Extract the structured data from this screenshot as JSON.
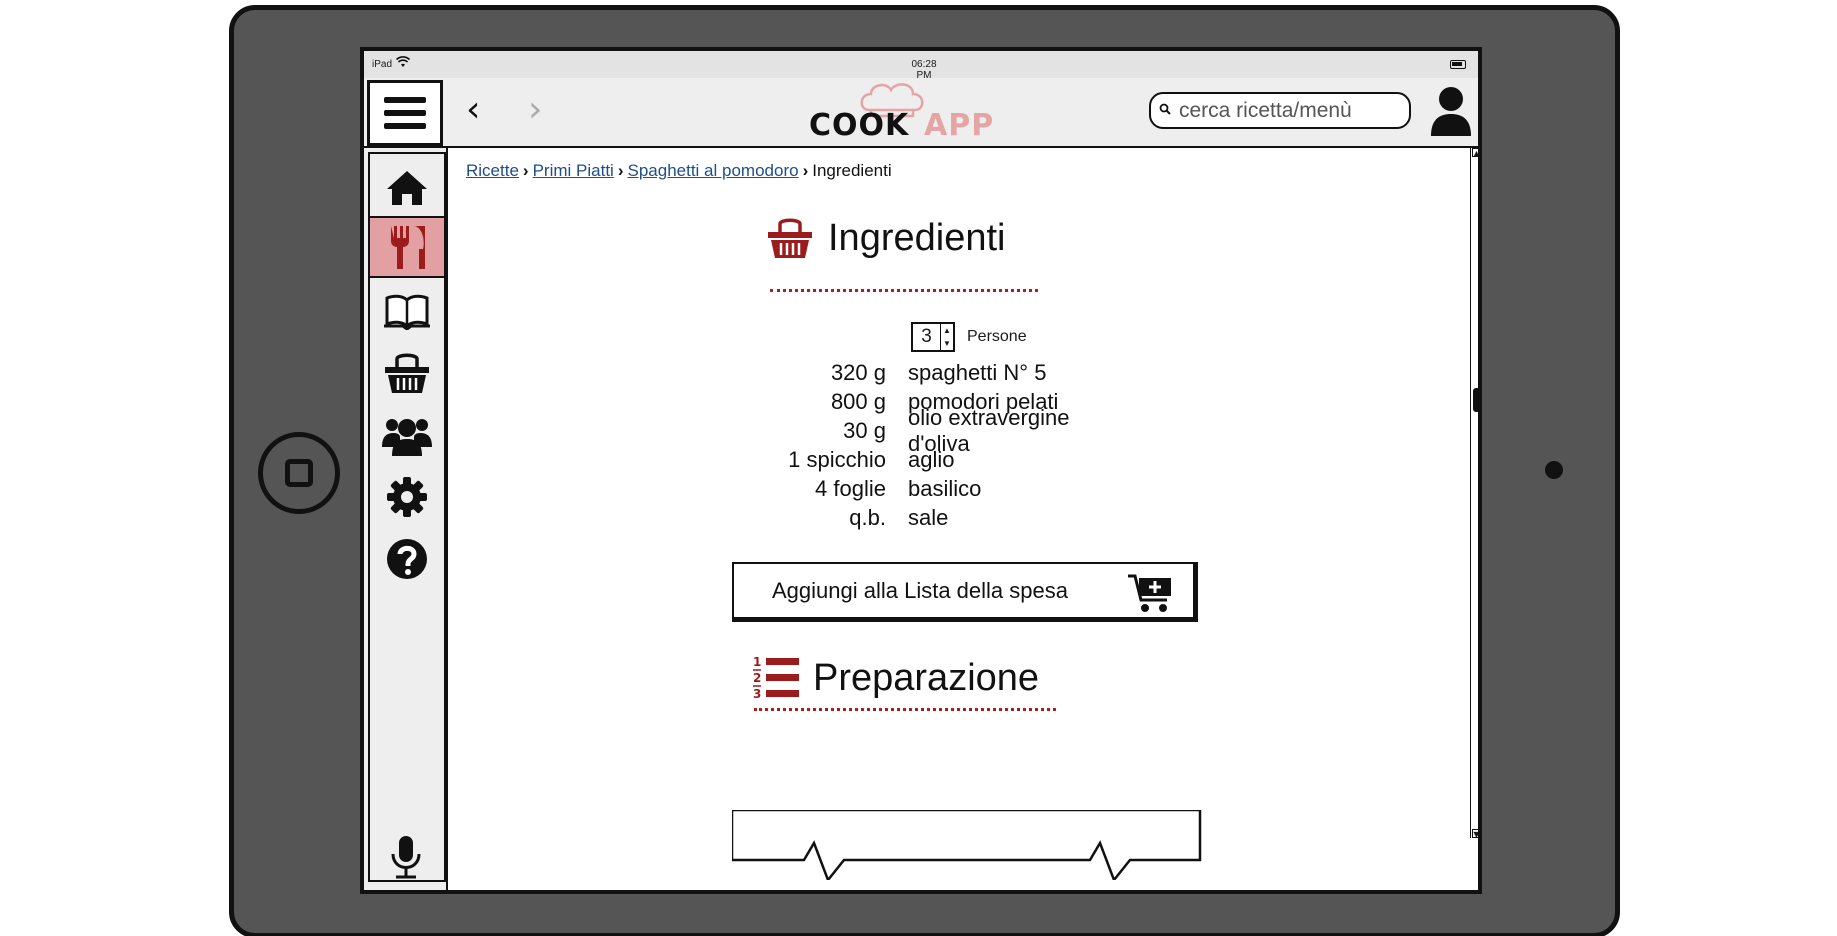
{
  "status_bar": {
    "device": "iPad",
    "time": "06:28 PM"
  },
  "header": {
    "logo_cook": "COOK",
    "logo_app": "APP",
    "search_placeholder": "cerca ricetta/menù"
  },
  "sidebar": {
    "items": [
      {
        "name": "home-icon"
      },
      {
        "name": "fork-knife-icon",
        "active": true
      },
      {
        "name": "book-icon"
      },
      {
        "name": "basket-icon"
      },
      {
        "name": "users-icon"
      },
      {
        "name": "gear-icon"
      },
      {
        "name": "help-icon"
      }
    ]
  },
  "breadcrumb": {
    "items": [
      "Ricette",
      "Primi Piatti",
      "Spaghetti al pomodoro"
    ],
    "current": "Ingredienti"
  },
  "ingredients_section": {
    "title": "Ingredienti",
    "servings_value": "3",
    "servings_label": "Persone",
    "rows": [
      {
        "qty": "320 g",
        "name": "spaghetti N° 5"
      },
      {
        "qty": "800 g",
        "name": "pomodori pelati"
      },
      {
        "qty": "30 g",
        "name": "olio extravergine d'oliva"
      },
      {
        "qty": "1 spicchio",
        "name": "aglio"
      },
      {
        "qty": "4 foglie",
        "name": "basilico"
      },
      {
        "qty": "q.b.",
        "name": "sale"
      }
    ],
    "add_button_label": "Aggiungi alla Lista della spesa"
  },
  "preparation_section": {
    "title": "Preparazione"
  },
  "colors": {
    "accent_red": "#9b1c1c",
    "active_bg": "#e3a0a3",
    "logo_pink": "#e6a5a5",
    "link_blue": "#1f4e8c"
  }
}
